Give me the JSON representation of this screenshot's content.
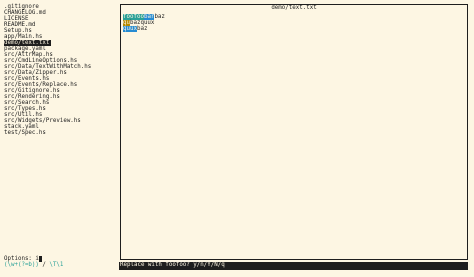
{
  "file_list": [
    ".gitignore",
    "CHANGELOG.md",
    "LICENSE",
    "README.md",
    "Setup.hs",
    "app/Main.hs",
    "demo/text.txt",
    "package.yaml",
    "src/AttrMap.hs",
    "src/CmdLineOptions.hs",
    "src/Data/TextWithMatch.hs",
    "src/Data/Zipper.hs",
    "src/Events.hs",
    "src/Events/Replace.hs",
    "src/Gitignore.hs",
    "src/Rendering.hs",
    "src/Search.hs",
    "src/Types.hs",
    "src/Util.hs",
    "src/Widgets/Preview.hs",
    "stack.yaml",
    "test/Spec.hs"
  ],
  "selected_file_index": 6,
  "options": {
    "label": "Options: ",
    "value": "i"
  },
  "search": {
    "pattern": "(\\w+(?=b))",
    "separator": " / ",
    "replacement": "\\T\\1"
  },
  "preview": {
    "title": "demo/text.txt",
    "lines": [
      [
        {
          "text": "foofoo",
          "style": "cur"
        },
        {
          "text": "bar",
          "style": "match"
        },
        {
          "text": "baz",
          "style": "plain"
        }
      ],
      [
        {
          "text": "qu",
          "style": "old"
        },
        {
          "text": "bazquux",
          "style": "plain"
        }
      ],
      [
        {
          "text": "quux",
          "style": "match"
        },
        {
          "text": "baz",
          "style": "plain"
        }
      ]
    ]
  },
  "status_bar": {
    "prompt": "Replace with foofoo? y/n/Y/N/q"
  },
  "colors": {
    "background": "#fdf6e3",
    "foreground": "#1e1e1e",
    "accent": "#2aa198",
    "match": "#268bd2",
    "old": "#b58900"
  }
}
